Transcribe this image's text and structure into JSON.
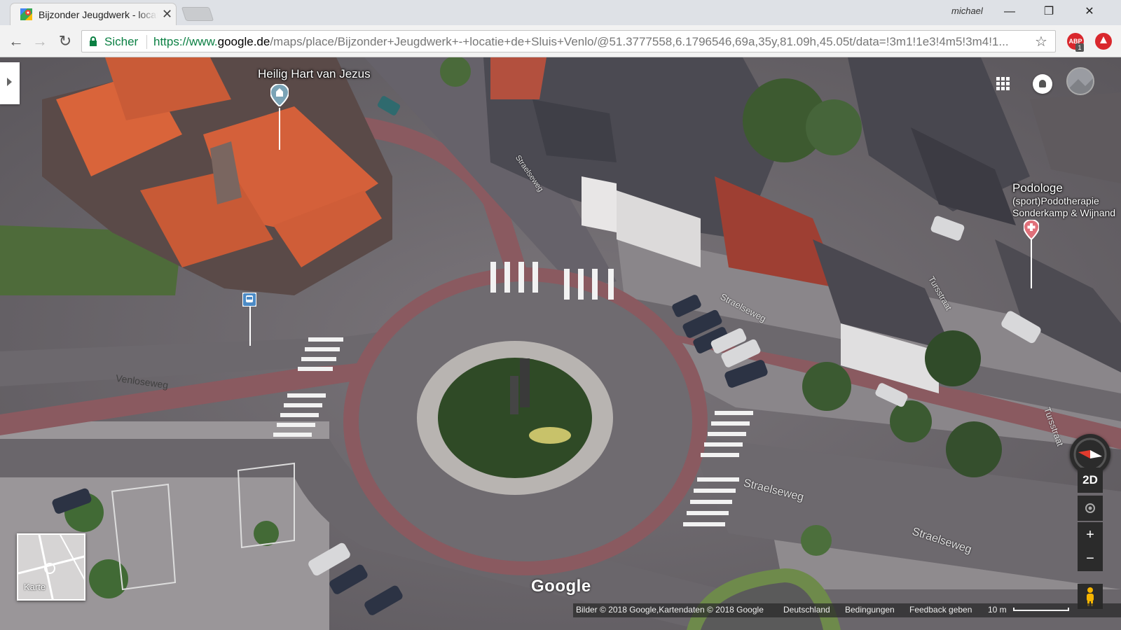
{
  "browser": {
    "tab": {
      "title": "Bijzonder Jeugdwerk - locatie de Sluis - Google Maps"
    },
    "profile_name": "michael",
    "window": {
      "minimize": "—",
      "maximize": "❐",
      "close": "✕"
    },
    "nav": {
      "back": "←",
      "forward": "→",
      "reload": "↻"
    },
    "omnibox": {
      "secure_label": "Sicher",
      "url_scheme": "https://www.",
      "url_domain": "google.de",
      "url_path": "/maps/place/Bijzonder+Jeugdwerk+-+locatie+de+Sluis+Venlo/@51.3777558,6.1796546,69a,35y,81.09h,45.05t/data=!3m1!1e3!4m5!3m4!1..."
    },
    "star": "☆",
    "extensions": {
      "abp_label": "ABP",
      "abp_badge": "1"
    }
  },
  "map": {
    "places": [
      {
        "name": "Heilig Hart van Jezus"
      },
      {
        "name": "Podologe",
        "sub1": "(sport)Podotherapie",
        "sub2": "Sonderkamp & Wijnand"
      }
    ],
    "streets": [
      "Straelseweg",
      "Straelseweg",
      "Straelseweg",
      "Straelseweg",
      "Venloseweg",
      "Tursstraat",
      "Tursstraat"
    ],
    "controls": {
      "tilt": "2D",
      "zoom_in": "+",
      "zoom_out": "−"
    },
    "minimap_label": "Karte",
    "logo": "Google",
    "footer": {
      "imagery": "Bilder © 2018 Google,Kartendaten © 2018 Google",
      "country": "Deutschland",
      "terms": "Bedingungen",
      "feedback": "Feedback geben",
      "scale": "10 m"
    }
  }
}
